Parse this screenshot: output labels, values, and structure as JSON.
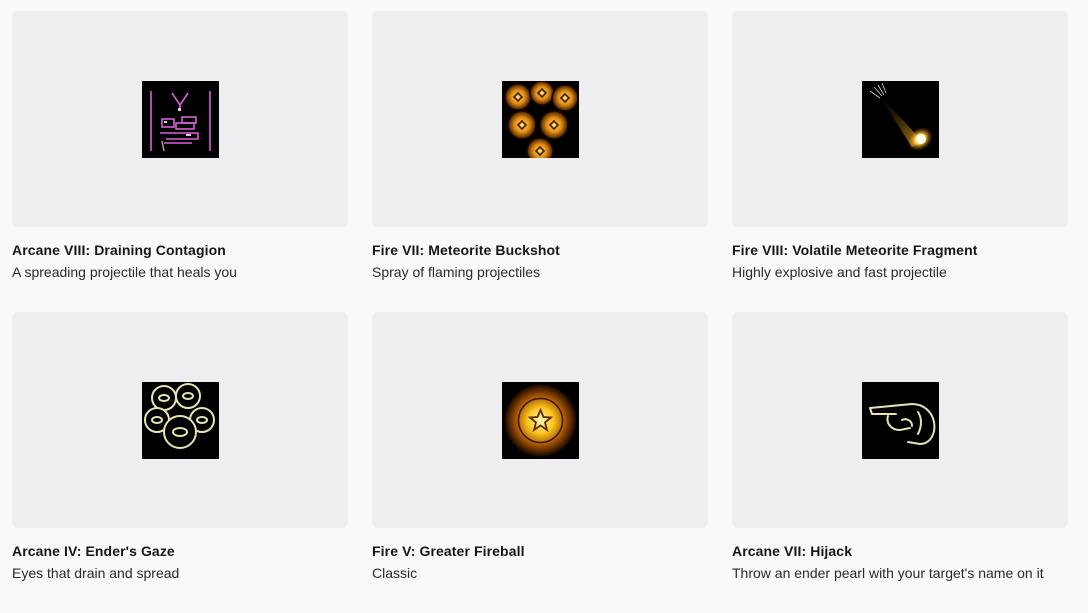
{
  "spells": [
    {
      "title": "Arcane VIII: Draining Contagion",
      "description": "A spreading projectile that heals you",
      "icon": "draining-contagion-icon"
    },
    {
      "title": "Fire VII: Meteorite Buckshot",
      "description": "Spray of flaming projectiles",
      "icon": "meteorite-buckshot-icon"
    },
    {
      "title": "Fire VIII: Volatile Meteorite Fragment",
      "description": "Highly explosive and fast projectile",
      "icon": "meteorite-fragment-icon"
    },
    {
      "title": "Arcane IV: Ender's Gaze",
      "description": "Eyes that drain and spread",
      "icon": "enders-gaze-icon"
    },
    {
      "title": "Fire V: Greater Fireball",
      "description": "Classic",
      "icon": "greater-fireball-icon"
    },
    {
      "title": "Arcane VII: Hijack",
      "description": "Throw an ender pearl with your target's name on it",
      "icon": "hijack-icon"
    }
  ],
  "colors": {
    "page_background": "#f9f9f9",
    "thumb_background": "#efeff1",
    "arcane_pink": "#e070e0",
    "fire_orange": "#f0a020",
    "ender_cream": "#e8e2b0"
  }
}
